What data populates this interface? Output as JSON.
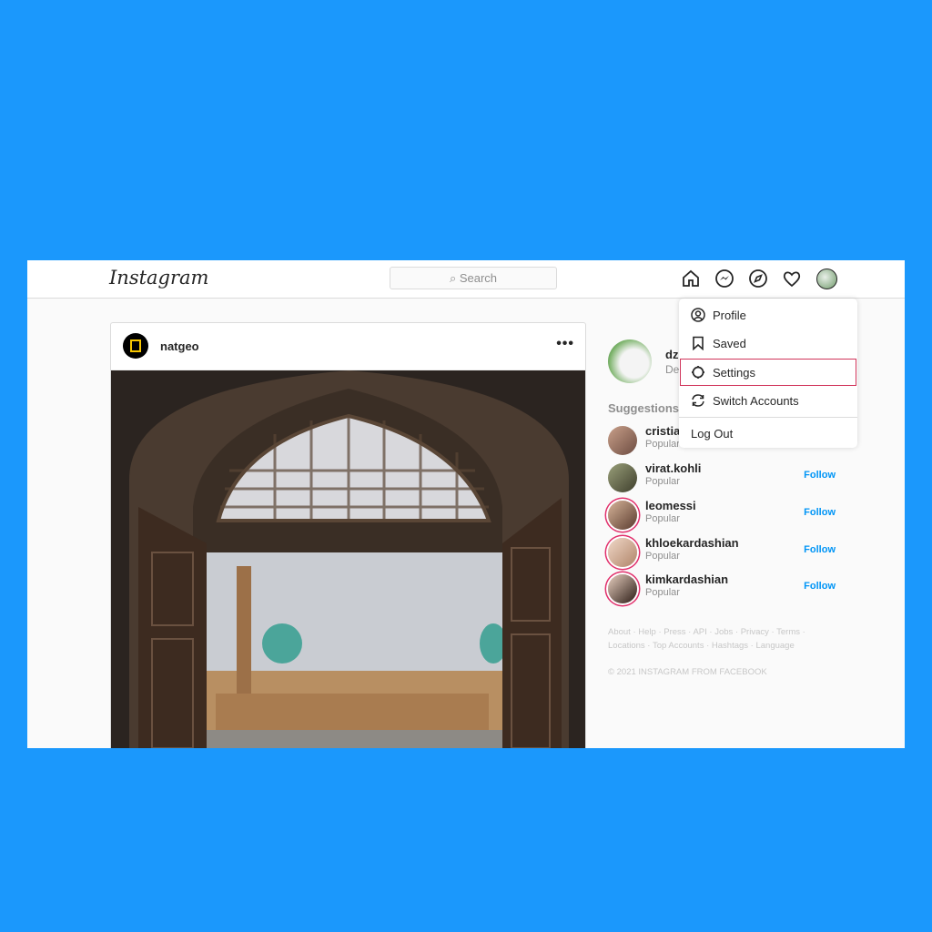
{
  "nav": {
    "logo": "Instagram",
    "search_placeholder": "Search"
  },
  "post": {
    "username": "natgeo",
    "more": "•••"
  },
  "profile": {
    "username": "dz",
    "subtitle": "De"
  },
  "suggestions": {
    "title": "Suggestions",
    "items": [
      {
        "name": "cristia",
        "sub": "Popular",
        "follow": ""
      },
      {
        "name": "virat.kohli",
        "sub": "Popular",
        "follow": "Follow"
      },
      {
        "name": "leomessi",
        "sub": "Popular",
        "follow": "Follow"
      },
      {
        "name": "khloekardashian",
        "sub": "Popular",
        "follow": "Follow"
      },
      {
        "name": "kimkardashian",
        "sub": "Popular",
        "follow": "Follow"
      }
    ]
  },
  "menu": {
    "items": [
      "Profile",
      "Saved",
      "Settings",
      "Switch Accounts"
    ],
    "logout": "Log Out",
    "highlighted": "Settings",
    "highlight_color": "#d0345a"
  },
  "footer": {
    "links1": "About · Help · Press · API · Jobs · Privacy · Terms ·",
    "links2": "Locations · Top Accounts · Hashtags · Language",
    "copyright": "© 2021 INSTAGRAM FROM FACEBOOK"
  },
  "colors": {
    "background": "#1b98fc",
    "link": "#0095f6"
  }
}
